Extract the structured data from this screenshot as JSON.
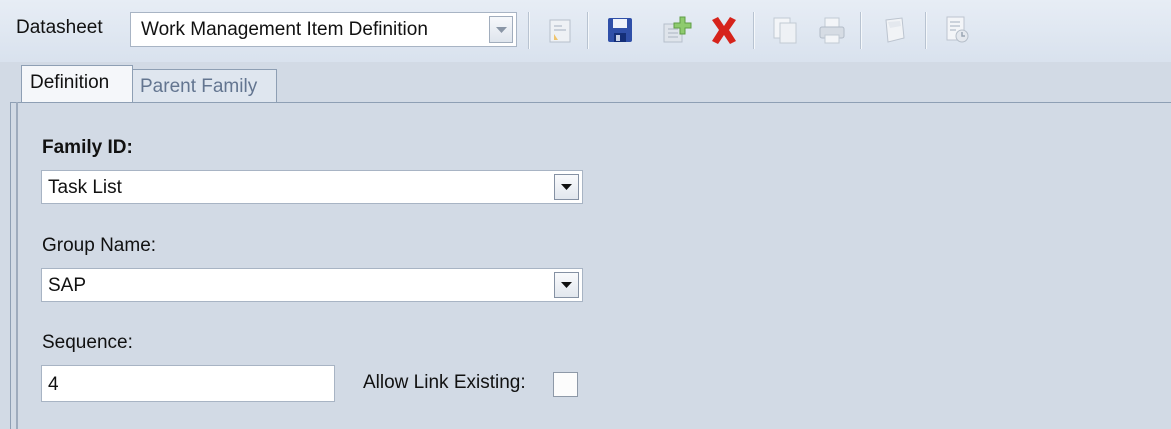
{
  "toolbar": {
    "datasheet_label": "Datasheet",
    "datasheet_value": "Work Management Item Definition",
    "icons": [
      "query-icon",
      "save-icon",
      "add-icon",
      "delete-icon",
      "copy-icon",
      "print-icon",
      "note-icon",
      "report-icon"
    ]
  },
  "tabs": [
    {
      "label": "Definition",
      "active": true
    },
    {
      "label": "Parent Family",
      "active": false
    }
  ],
  "form": {
    "family_id_label": "Family ID:",
    "family_id_value": "Task List",
    "group_name_label": "Group Name:",
    "group_name_value": "SAP",
    "sequence_label": "Sequence:",
    "sequence_value": "4",
    "allow_link_label": "Allow Link Existing:",
    "allow_link_checked": false
  },
  "colors": {
    "background": "#d2dae5",
    "delete_red": "#d6231b",
    "save_blue": "#2f4fa8"
  }
}
